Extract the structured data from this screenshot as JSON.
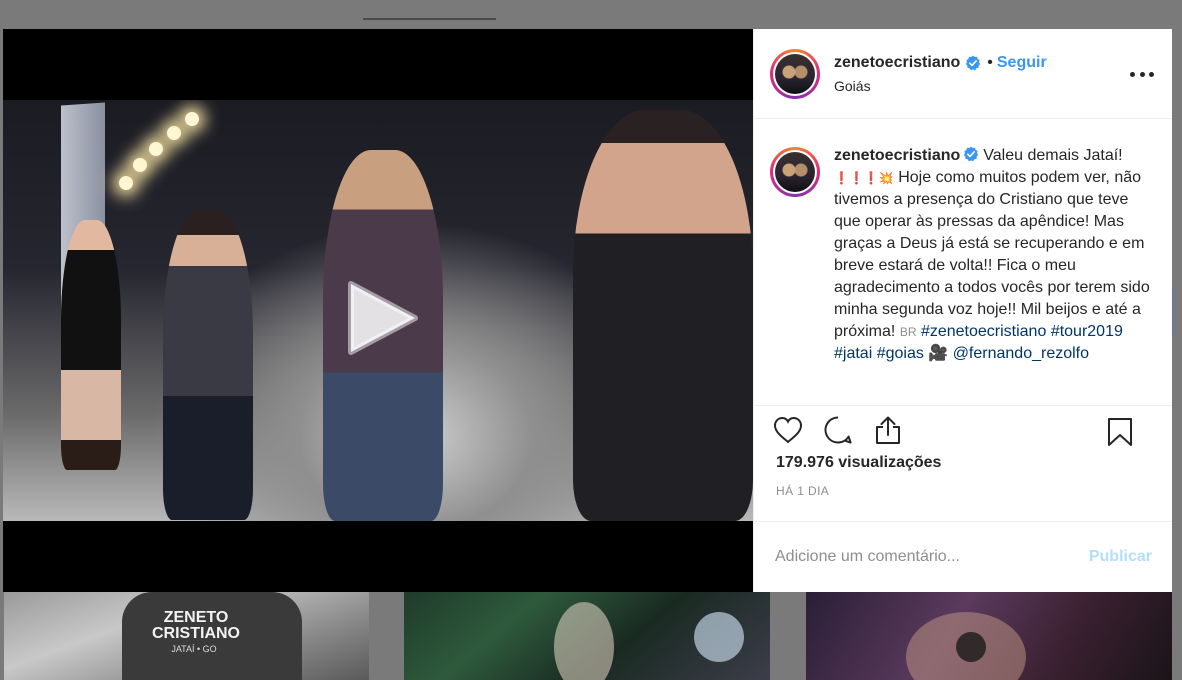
{
  "post": {
    "username": "zenetoecristiano",
    "location": "Goiás",
    "follow_label": "Seguir",
    "dot": "•",
    "caption_intro": "Valeu demais Jataí!",
    "caption_emoji": "❗❗❗💥",
    "caption_body": "Hoje como muitos podem ver, não tivemos a presença do Cristiano que teve que operar às pressas da apêndice! Mas graças a Deus já está se recuperando e em breve estará de volta!! Fica o meu agradecimento a todos vocês por terem sido minha segunda voz hoje!! Mil beijos e até a próxima!",
    "flag": "BR",
    "hashtags": [
      "#zenetoecristiano",
      "#tour2019",
      "#jatai",
      "#goias"
    ],
    "camera_emoji": "🎥",
    "mention": "@fernando_rezolfo",
    "views": "179.976 visualizações",
    "time_ago": "HÁ 1 DIA"
  },
  "comment": {
    "placeholder": "Adicione um comentário...",
    "publish_label": "Publicar"
  },
  "thumbnails": {
    "first_logo": "ZENETO CRISTIANO",
    "first_sub": "JATAÍ • GO"
  },
  "icons": {
    "more": "more-horizontal-icon",
    "like": "heart-icon",
    "comment": "comment-bubble-icon",
    "share": "share-icon",
    "save": "bookmark-icon",
    "verified": "verified-badge-icon",
    "play": "play-icon"
  },
  "colors": {
    "link": "#3897f0",
    "hashtag": "#003569",
    "publish_disabled": "#b2dffc",
    "overlay": "#7a7a7a"
  }
}
